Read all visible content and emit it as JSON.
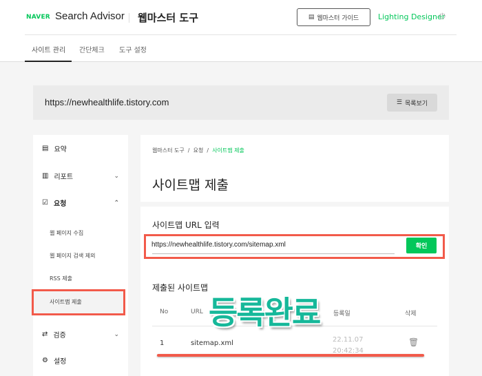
{
  "header": {
    "brand": "NAVER",
    "product": "Search Advisor",
    "tool": "웹마스터 도구",
    "guide_label": "웹마스터 가이드",
    "user": "Lighting Designer"
  },
  "tabs": [
    {
      "label": "사이트 관리",
      "active": true
    },
    {
      "label": "간단체크"
    },
    {
      "label": "도구 설정"
    }
  ],
  "site": {
    "url": "https://newhealthlife.tistory.com",
    "list_label": "목록보기"
  },
  "sidebar": {
    "items": [
      {
        "label": "요약"
      },
      {
        "label": "리포트"
      },
      {
        "label": "요청"
      },
      {
        "label": "검증"
      },
      {
        "label": "설정"
      }
    ],
    "sub_items": [
      {
        "label": "웹 페이지 수집"
      },
      {
        "label": "웹 페이지 검색 제외"
      },
      {
        "label": "RSS 제출"
      },
      {
        "label": "사이트맵 제출",
        "active": true
      }
    ]
  },
  "main": {
    "breadcrumb": [
      "웹마스터 도구",
      "요청",
      "사이트맵 제출"
    ],
    "title": "사이트맵 제출",
    "input_label": "사이트맵 URL 입력",
    "input_value": "https://newhealthlife.tistory.com/sitemap.xml",
    "confirm_label": "확인",
    "list_title": "제출된 사이트맵",
    "columns": [
      "No",
      "URL",
      "등록일",
      "삭제"
    ],
    "rows": [
      {
        "no": "1",
        "url": "sitemap.xml",
        "date": "22.11.07 20:42:34"
      }
    ]
  },
  "overlay": {
    "text": "등록완료",
    "color": "#16b89a",
    "highlight_color": "#f25a4a"
  }
}
